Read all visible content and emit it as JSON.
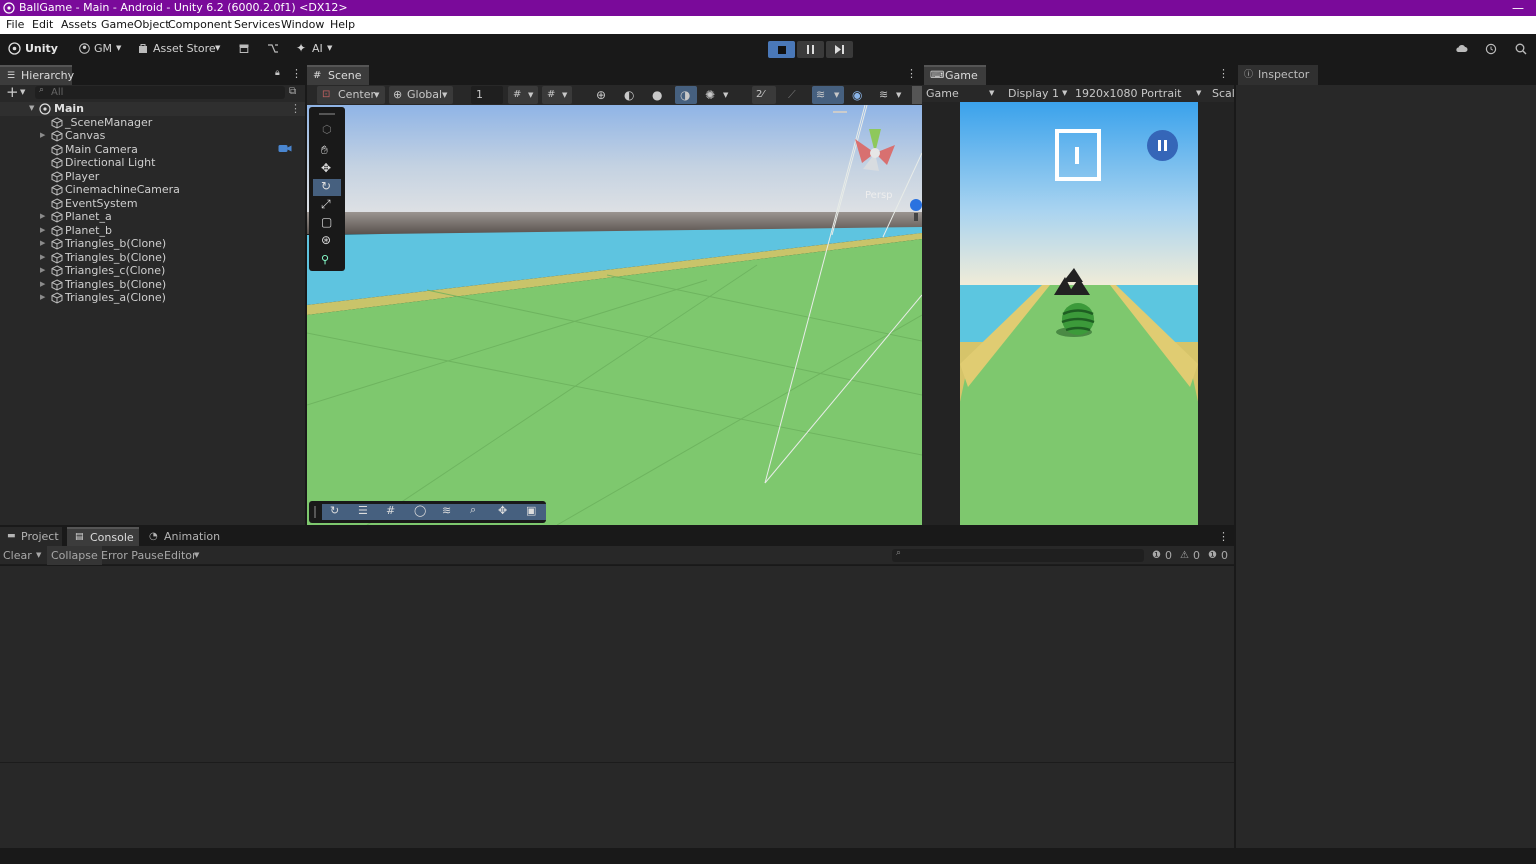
{
  "window": {
    "title": "BallGame - Main - Android - Unity 6.2 (6000.2.0f1) <DX12>",
    "minimize": "—",
    "title_bar_color": "#7a0a9a"
  },
  "menu": [
    "File",
    "Edit",
    "Assets",
    "GameObject",
    "Component",
    "Services",
    "Window",
    "Help"
  ],
  "toolbar": {
    "unity_label": "Unity 6",
    "account": "GM",
    "asset_store": "Asset Store",
    "ai": "AI",
    "play_active_color": "#4a78b8"
  },
  "hierarchy": {
    "tab": "Hierarchy",
    "search_placeholder": "All",
    "scene": "Main",
    "items": [
      {
        "label": "_SceneManager",
        "expandable": false
      },
      {
        "label": "Canvas",
        "expandable": true
      },
      {
        "label": "Main Camera",
        "expandable": false
      },
      {
        "label": "Directional Light",
        "expandable": false
      },
      {
        "label": "Player",
        "expandable": false
      },
      {
        "label": "CinemachineCamera",
        "expandable": false
      },
      {
        "label": "EventSystem",
        "expandable": false
      },
      {
        "label": "Planet_a",
        "expandable": true
      },
      {
        "label": "Planet_b",
        "expandable": true
      },
      {
        "label": "Triangles_b(Clone)",
        "expandable": true
      },
      {
        "label": "Triangles_b(Clone)",
        "expandable": true
      },
      {
        "label": "Triangles_c(Clone)",
        "expandable": true
      },
      {
        "label": "Triangles_b(Clone)",
        "expandable": true
      },
      {
        "label": "Triangles_a(Clone)",
        "expandable": true
      }
    ]
  },
  "scene_view": {
    "tab": "Scene",
    "pivot": "Center",
    "space": "Global",
    "grid_value": "1",
    "projection": "Persp"
  },
  "game_view": {
    "tab": "Game",
    "mode": "Game",
    "display": "Display 1",
    "resolution": "1920x1080 Portrait",
    "scale": "Scal"
  },
  "inspector": {
    "tab": "Inspector"
  },
  "bottom": {
    "tabs": [
      "Project",
      "Console",
      "Animation"
    ],
    "clear": "Clear",
    "collapse": "Collapse",
    "error_pause": "Error Pause",
    "editor": "Editor",
    "log_count": "0",
    "warn_count": "0",
    "error_count": "0"
  }
}
